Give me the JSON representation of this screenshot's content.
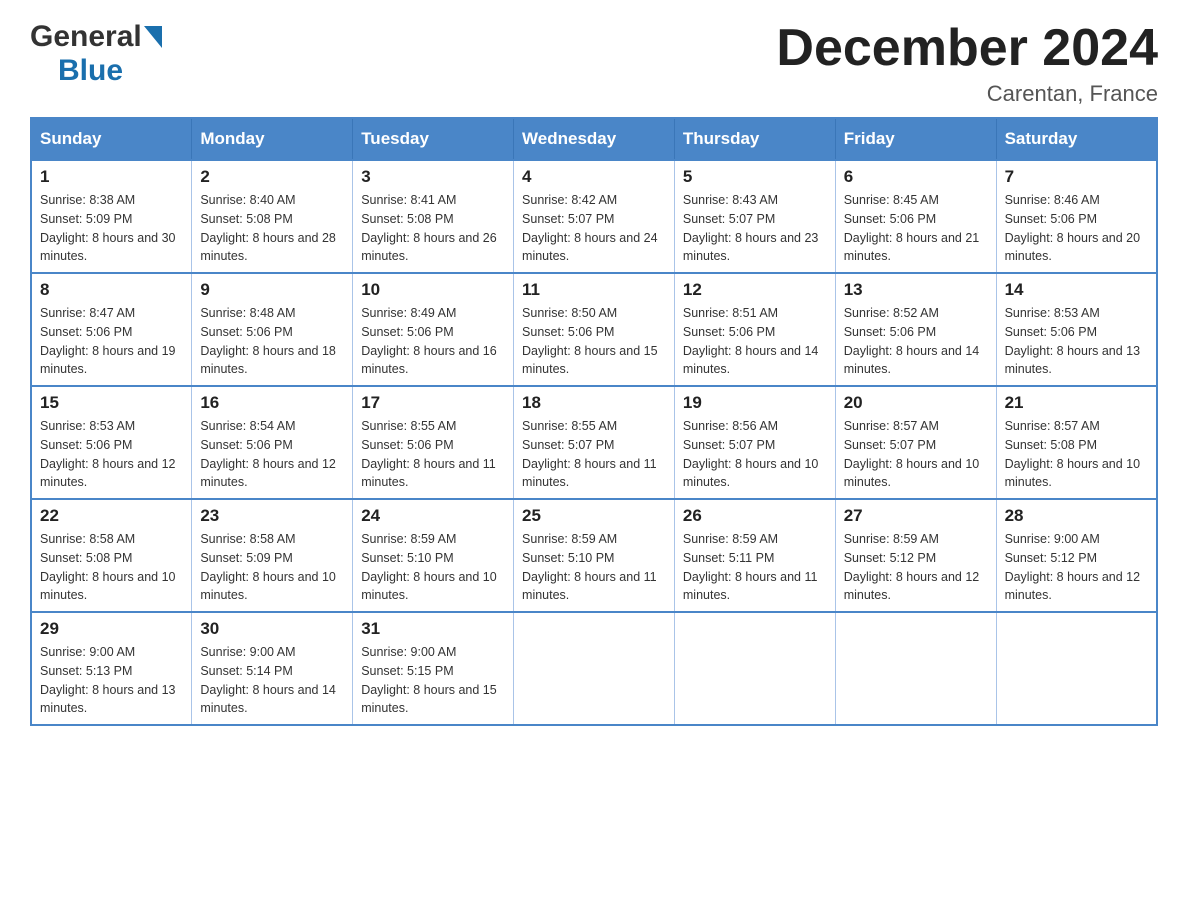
{
  "header": {
    "month_title": "December 2024",
    "location": "Carentan, France",
    "logo_general": "General",
    "logo_blue": "Blue"
  },
  "days_of_week": [
    "Sunday",
    "Monday",
    "Tuesday",
    "Wednesday",
    "Thursday",
    "Friday",
    "Saturday"
  ],
  "weeks": [
    [
      {
        "day": "1",
        "sunrise": "8:38 AM",
        "sunset": "5:09 PM",
        "daylight": "8 hours and 30 minutes."
      },
      {
        "day": "2",
        "sunrise": "8:40 AM",
        "sunset": "5:08 PM",
        "daylight": "8 hours and 28 minutes."
      },
      {
        "day": "3",
        "sunrise": "8:41 AM",
        "sunset": "5:08 PM",
        "daylight": "8 hours and 26 minutes."
      },
      {
        "day": "4",
        "sunrise": "8:42 AM",
        "sunset": "5:07 PM",
        "daylight": "8 hours and 24 minutes."
      },
      {
        "day": "5",
        "sunrise": "8:43 AM",
        "sunset": "5:07 PM",
        "daylight": "8 hours and 23 minutes."
      },
      {
        "day": "6",
        "sunrise": "8:45 AM",
        "sunset": "5:06 PM",
        "daylight": "8 hours and 21 minutes."
      },
      {
        "day": "7",
        "sunrise": "8:46 AM",
        "sunset": "5:06 PM",
        "daylight": "8 hours and 20 minutes."
      }
    ],
    [
      {
        "day": "8",
        "sunrise": "8:47 AM",
        "sunset": "5:06 PM",
        "daylight": "8 hours and 19 minutes."
      },
      {
        "day": "9",
        "sunrise": "8:48 AM",
        "sunset": "5:06 PM",
        "daylight": "8 hours and 18 minutes."
      },
      {
        "day": "10",
        "sunrise": "8:49 AM",
        "sunset": "5:06 PM",
        "daylight": "8 hours and 16 minutes."
      },
      {
        "day": "11",
        "sunrise": "8:50 AM",
        "sunset": "5:06 PM",
        "daylight": "8 hours and 15 minutes."
      },
      {
        "day": "12",
        "sunrise": "8:51 AM",
        "sunset": "5:06 PM",
        "daylight": "8 hours and 14 minutes."
      },
      {
        "day": "13",
        "sunrise": "8:52 AM",
        "sunset": "5:06 PM",
        "daylight": "8 hours and 14 minutes."
      },
      {
        "day": "14",
        "sunrise": "8:53 AM",
        "sunset": "5:06 PM",
        "daylight": "8 hours and 13 minutes."
      }
    ],
    [
      {
        "day": "15",
        "sunrise": "8:53 AM",
        "sunset": "5:06 PM",
        "daylight": "8 hours and 12 minutes."
      },
      {
        "day": "16",
        "sunrise": "8:54 AM",
        "sunset": "5:06 PM",
        "daylight": "8 hours and 12 minutes."
      },
      {
        "day": "17",
        "sunrise": "8:55 AM",
        "sunset": "5:06 PM",
        "daylight": "8 hours and 11 minutes."
      },
      {
        "day": "18",
        "sunrise": "8:55 AM",
        "sunset": "5:07 PM",
        "daylight": "8 hours and 11 minutes."
      },
      {
        "day": "19",
        "sunrise": "8:56 AM",
        "sunset": "5:07 PM",
        "daylight": "8 hours and 10 minutes."
      },
      {
        "day": "20",
        "sunrise": "8:57 AM",
        "sunset": "5:07 PM",
        "daylight": "8 hours and 10 minutes."
      },
      {
        "day": "21",
        "sunrise": "8:57 AM",
        "sunset": "5:08 PM",
        "daylight": "8 hours and 10 minutes."
      }
    ],
    [
      {
        "day": "22",
        "sunrise": "8:58 AM",
        "sunset": "5:08 PM",
        "daylight": "8 hours and 10 minutes."
      },
      {
        "day": "23",
        "sunrise": "8:58 AM",
        "sunset": "5:09 PM",
        "daylight": "8 hours and 10 minutes."
      },
      {
        "day": "24",
        "sunrise": "8:59 AM",
        "sunset": "5:10 PM",
        "daylight": "8 hours and 10 minutes."
      },
      {
        "day": "25",
        "sunrise": "8:59 AM",
        "sunset": "5:10 PM",
        "daylight": "8 hours and 11 minutes."
      },
      {
        "day": "26",
        "sunrise": "8:59 AM",
        "sunset": "5:11 PM",
        "daylight": "8 hours and 11 minutes."
      },
      {
        "day": "27",
        "sunrise": "8:59 AM",
        "sunset": "5:12 PM",
        "daylight": "8 hours and 12 minutes."
      },
      {
        "day": "28",
        "sunrise": "9:00 AM",
        "sunset": "5:12 PM",
        "daylight": "8 hours and 12 minutes."
      }
    ],
    [
      {
        "day": "29",
        "sunrise": "9:00 AM",
        "sunset": "5:13 PM",
        "daylight": "8 hours and 13 minutes."
      },
      {
        "day": "30",
        "sunrise": "9:00 AM",
        "sunset": "5:14 PM",
        "daylight": "8 hours and 14 minutes."
      },
      {
        "day": "31",
        "sunrise": "9:00 AM",
        "sunset": "5:15 PM",
        "daylight": "8 hours and 15 minutes."
      },
      null,
      null,
      null,
      null
    ]
  ],
  "labels": {
    "sunrise": "Sunrise:",
    "sunset": "Sunset:",
    "daylight": "Daylight:"
  }
}
